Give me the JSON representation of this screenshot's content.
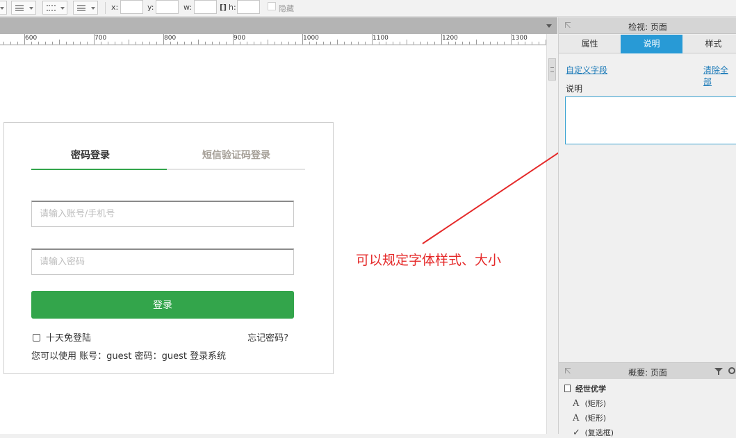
{
  "toolbar": {
    "x_label": "x:",
    "y_label": "y:",
    "w_label": "w:",
    "h_label": "h:",
    "hidden_label": "隐藏"
  },
  "ruler": {
    "labels": [
      "600",
      "700",
      "800",
      "900",
      "1000",
      "1100",
      "1200",
      "1300"
    ]
  },
  "login": {
    "tab_password": "密码登录",
    "tab_sms": "短信验证码登录",
    "account_placeholder": "请输入账号/手机号",
    "password_placeholder": "请输入密码",
    "login_button": "登录",
    "remember_label": "十天免登陆",
    "forgot_label": "忘记密码?",
    "hint": "您可以使用 账号：guest 密码：guest 登录系统"
  },
  "annotation": {
    "text": "可以规定字体样式、大小",
    "color": "#e52a2a"
  },
  "inspector": {
    "title": "检视: 页面",
    "tabs": [
      "属性",
      "说明",
      "样式"
    ],
    "active_tab": "说明",
    "custom_fields_link": "自定义字段",
    "clear_all_link": "清除全部",
    "notes_label": "说明",
    "notes_value": ""
  },
  "outline": {
    "title": "概要: 页面",
    "root": "经世优学",
    "items": [
      "(矩形)",
      "(矩形)",
      "(复选框)"
    ],
    "item_icons": [
      "text-icon",
      "text-icon",
      "checkmark-icon"
    ]
  },
  "colors": {
    "accent_green": "#33a54b",
    "panel_blue": "#289ad6",
    "link_blue": "#1b7ab8",
    "annotation_red": "#e52a2a"
  }
}
